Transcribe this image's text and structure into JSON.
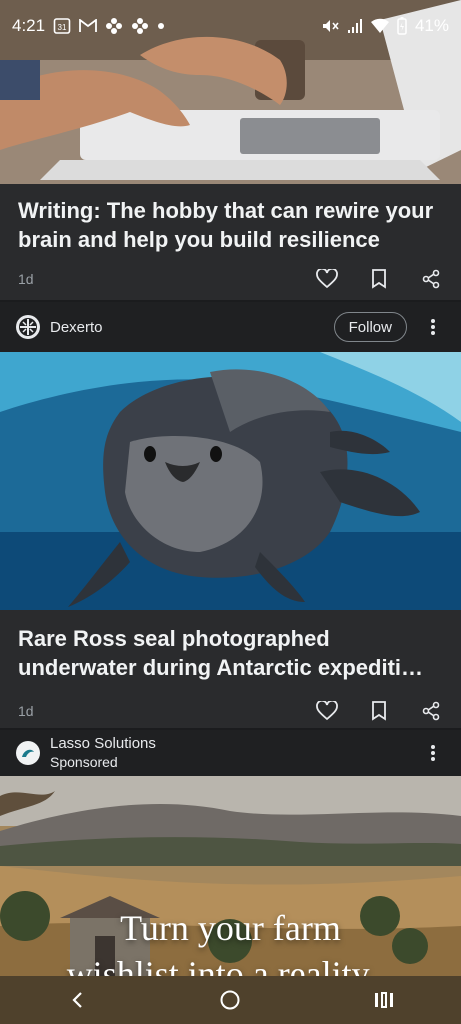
{
  "status_bar": {
    "time": "4:21",
    "calendar_day": "31",
    "battery_percent": "41%",
    "icons": [
      "calendar-icon",
      "gmail-icon",
      "pinwheel-icon",
      "pinwheel-icon",
      "dot-icon",
      "mute-icon",
      "signal-icon",
      "wifi-icon",
      "battery-icon"
    ]
  },
  "feed": {
    "card1": {
      "headline": "Writing: The hobby that can rewire your brain and help you build resilience",
      "age": "1d"
    },
    "source2": {
      "name": "Dexerto",
      "follow_label": "Follow"
    },
    "card2": {
      "headline": "Rare Ross seal photographed underwater during Antarctic expediti…",
      "age": "1d"
    },
    "ad": {
      "advertiser": "Lasso Solutions",
      "sponsored_label": "Sponsored",
      "ad_text_line1": "Turn your farm",
      "ad_text_line2": "wishlist into a reality..."
    }
  },
  "nav": {
    "icons": [
      "back-icon",
      "home-icon",
      "recents-icon"
    ]
  },
  "colors": {
    "background": "#1b1c1e",
    "card": "#2a2b2d",
    "text": "#e8eaed",
    "muted": "#9aa0a6"
  }
}
